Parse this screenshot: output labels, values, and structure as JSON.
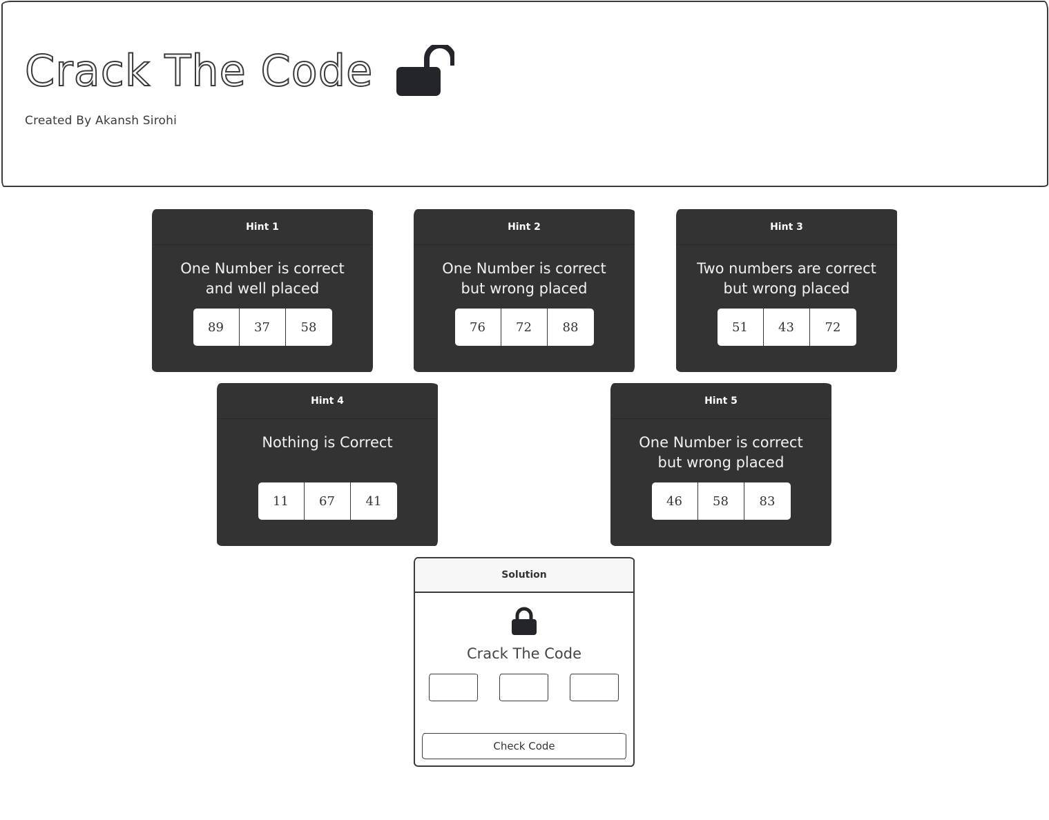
{
  "header": {
    "title": "Crack The Code",
    "subtitle": "Created By Akansh Sirohi",
    "icon": "unlock-icon"
  },
  "hints": [
    {
      "label": "Hint 1",
      "text": "One Number is correct and well placed",
      "digits": [
        "89",
        "37",
        "58"
      ]
    },
    {
      "label": "Hint 2",
      "text": "One Number is correct but wrong placed",
      "digits": [
        "76",
        "72",
        "88"
      ]
    },
    {
      "label": "Hint 3",
      "text": "Two numbers are correct but wrong placed",
      "digits": [
        "51",
        "43",
        "72"
      ]
    },
    {
      "label": "Hint 4",
      "text": "Nothing is Correct",
      "digits": [
        "11",
        "67",
        "41"
      ]
    },
    {
      "label": "Hint 5",
      "text": "One Number is correct but wrong placed",
      "digits": [
        "46",
        "58",
        "83"
      ]
    }
  ],
  "solution": {
    "label": "Solution",
    "icon": "lock-icon",
    "title": "Crack The Code",
    "inputs": [
      "",
      "",
      ""
    ],
    "button_label": "Check Code"
  },
  "colors": {
    "card_background": "#333333",
    "border": "#3a3a3a",
    "page_background": "#ffffff"
  }
}
